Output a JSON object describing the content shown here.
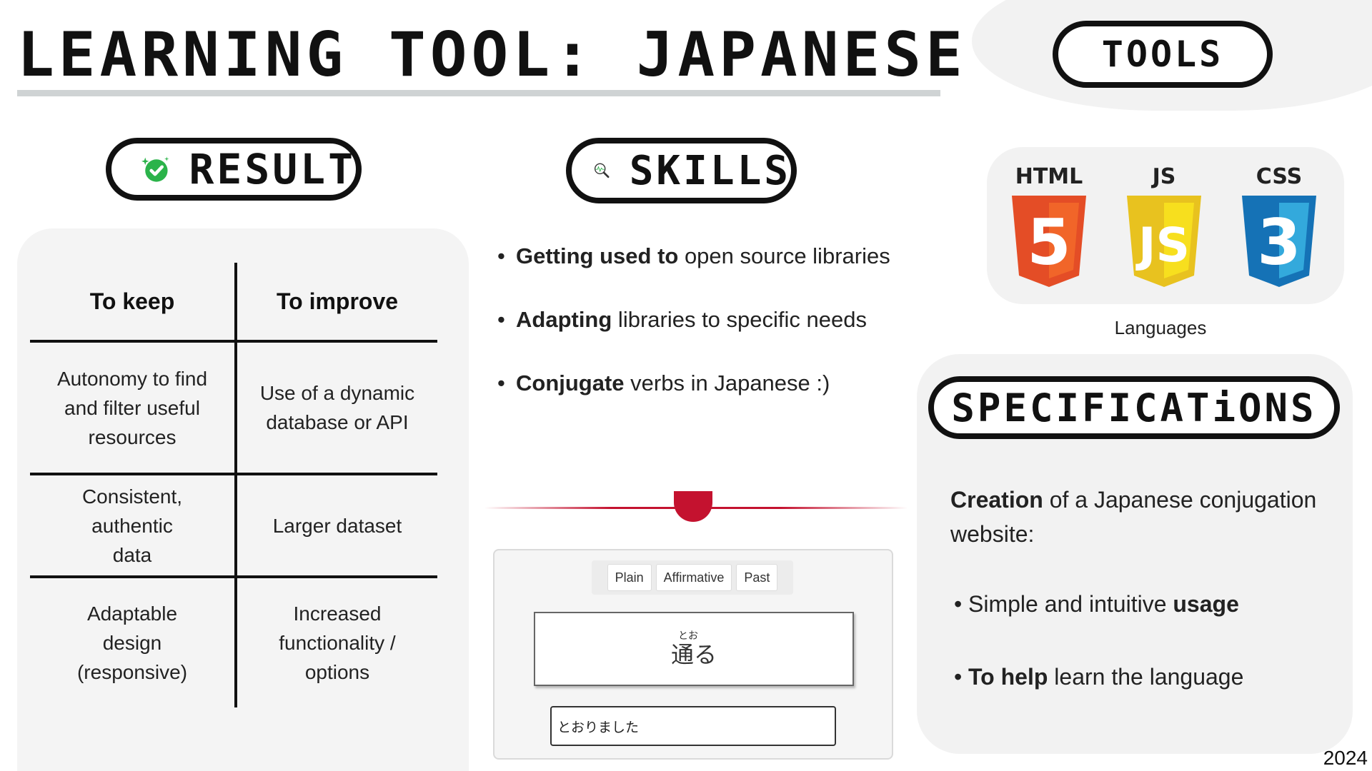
{
  "title": "LEARNING TOOL: JAPANESE CONJUGATOR",
  "tools": {
    "heading": "TOOLS",
    "languages": [
      {
        "name": "HTML",
        "digit": "5",
        "icon": "html5-icon",
        "color": "#e44d26",
        "color_light": "#f16529"
      },
      {
        "name": "JS",
        "digit": "JS",
        "icon": "javascript-icon",
        "color": "#e8c21f",
        "color_light": "#f7df1e"
      },
      {
        "name": "CSS",
        "digit": "3",
        "icon": "css3-icon",
        "color": "#1572b6",
        "color_light": "#33a9dc"
      }
    ],
    "languages_label": "Languages"
  },
  "result": {
    "heading": "RESULT",
    "icon": "check-badge-icon",
    "table": {
      "headers": [
        "To keep",
        "To improve"
      ],
      "rows": [
        [
          "Autonomy to find and filter useful resources",
          "Use of a dynamic database or API"
        ],
        [
          "Consistent, authentic data",
          "Larger dataset"
        ],
        [
          "Adaptable design (responsive)",
          "Increased functionality / options"
        ]
      ]
    }
  },
  "skills": {
    "heading": "SKILLS",
    "icon": "magnifier-icon",
    "items": [
      {
        "bold": "Getting used to",
        "rest": " open source libraries"
      },
      {
        "bold": "Adapting",
        "rest": " libraries to specific needs"
      },
      {
        "bold": "Conjugate",
        "rest": " verbs in Japanese :)"
      }
    ]
  },
  "demo": {
    "tabs": [
      "Plain",
      "Affirmative",
      "Past"
    ],
    "verb_reading": "とお",
    "verb": "通る",
    "answer_value": "とおりました"
  },
  "specifications": {
    "heading": "SPECIFICATiONS",
    "intro_bold": "Creation",
    "intro_rest": " of a Japanese conjugation website:",
    "bullets": [
      {
        "pre": "Simple and intuitive ",
        "bold": "usage",
        "post": ""
      },
      {
        "pre": "",
        "bold": "To help",
        "post": " learn the language"
      }
    ]
  },
  "year": "2024",
  "colors": {
    "accent_red": "#c4122f",
    "check_green": "#2bb34a",
    "panel_gray": "#f2f2f2"
  }
}
